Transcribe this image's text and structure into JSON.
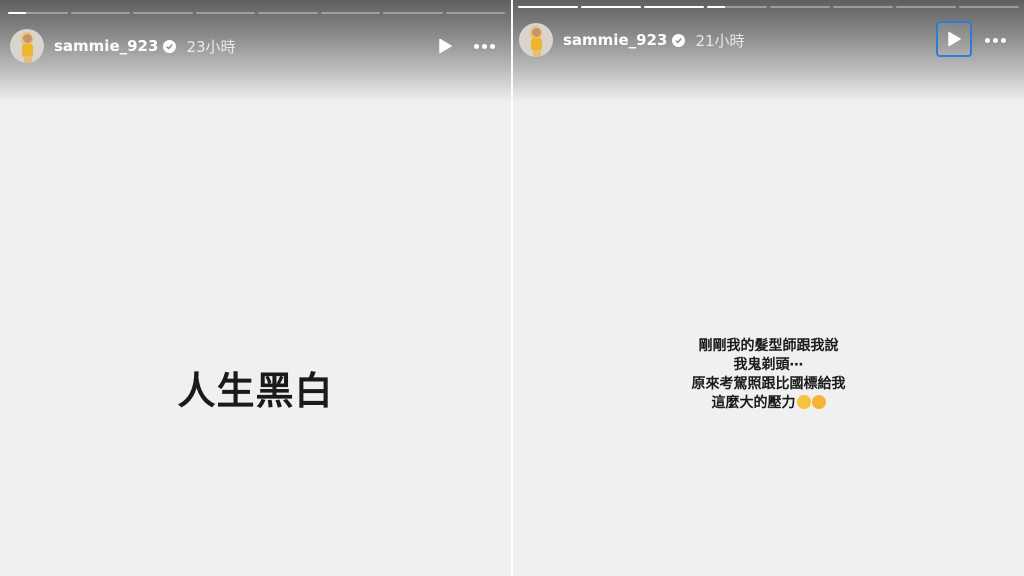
{
  "stories": [
    {
      "username": "sammie_923",
      "time": "23小時",
      "progress": {
        "segments": 8,
        "active_index": 0,
        "active_fill": 0.3
      },
      "text": "人生黑白",
      "avatar_icon": "avatar-photo",
      "play_icon": "play-icon",
      "more_icon": "more-icon"
    },
    {
      "username": "sammie_923",
      "time": "21小時",
      "progress": {
        "segments": 8,
        "active_index": 3,
        "active_fill": 0.3
      },
      "lines": [
        "剛剛我的髮型師跟我說",
        "我鬼剃頭⋯",
        "原來考駕照跟比國標給我",
        "這麼大的壓力"
      ],
      "emojis": [
        "flushed-face-icon",
        "bandaged-face-icon"
      ],
      "play_icon": "play-icon",
      "more_icon": "more-icon"
    }
  ],
  "colors": {
    "accent_focus": "#2f7cd6",
    "background": "#f0f0f0",
    "text": "#1a1a1a"
  }
}
